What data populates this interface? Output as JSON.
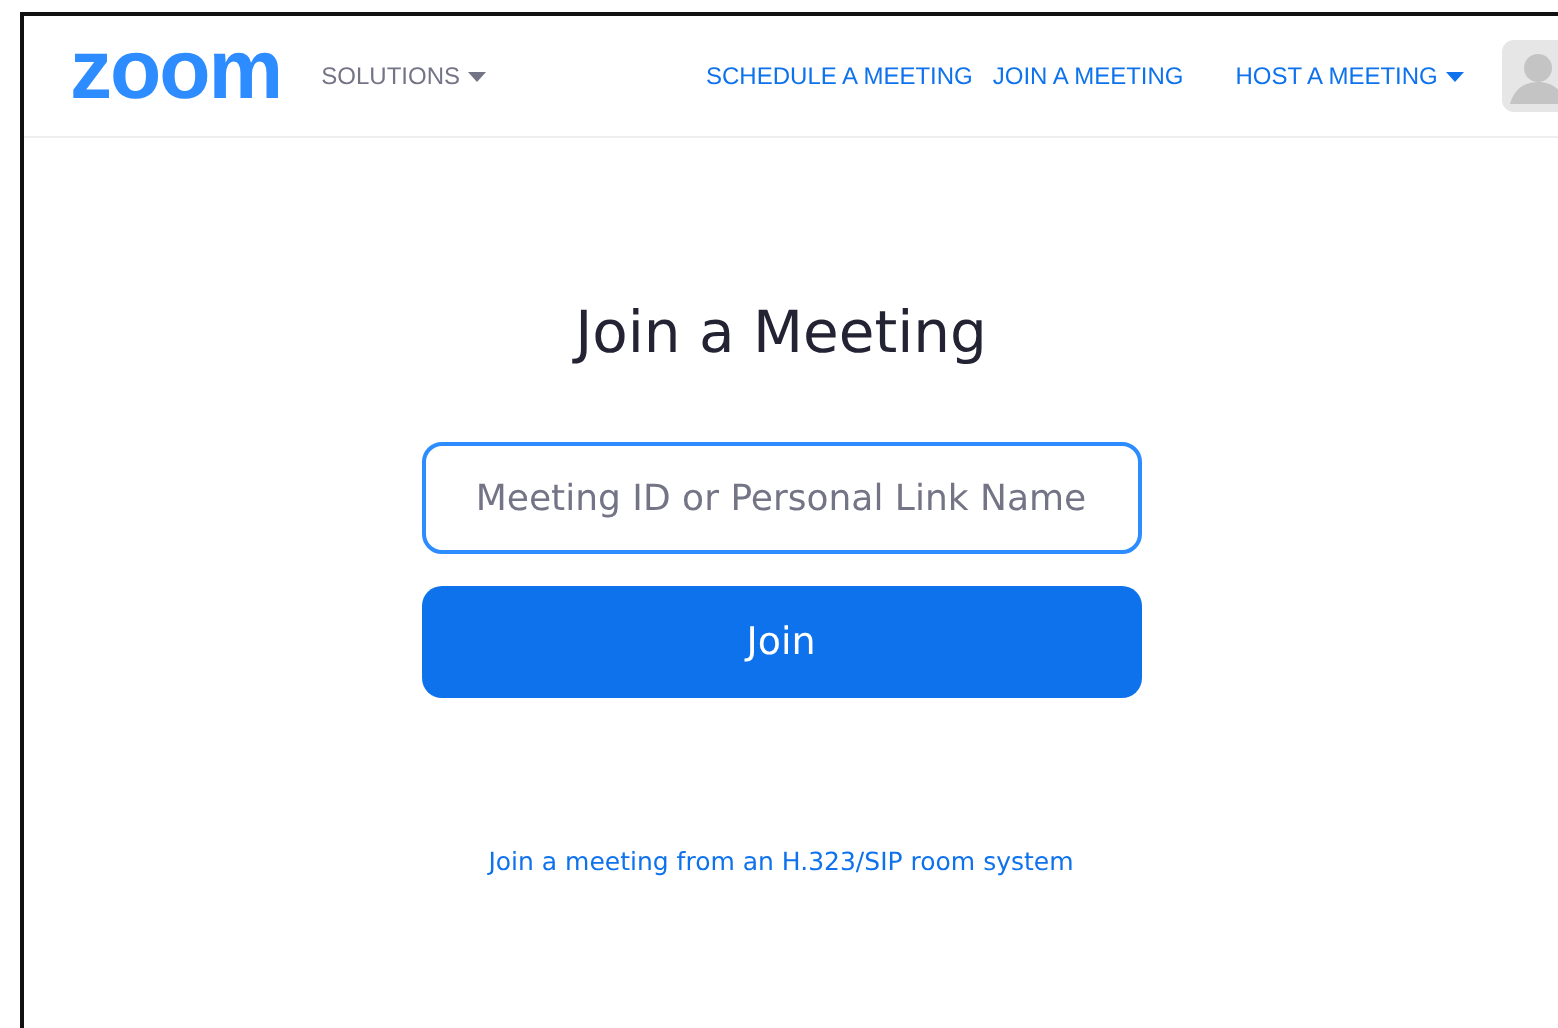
{
  "header": {
    "logo": "zoom",
    "nav_left": [
      {
        "label": "SOLUTIONS",
        "dropdown": true
      }
    ],
    "nav_right": [
      {
        "label": "SCHEDULE A MEETING",
        "dropdown": false
      },
      {
        "label": "JOIN A MEETING",
        "dropdown": false
      },
      {
        "label": "HOST A MEETING",
        "dropdown": true
      }
    ]
  },
  "title": "Join a Meeting",
  "meeting_field": {
    "placeholder": "Meeting ID or Personal Link Name",
    "focused": true
  },
  "join_button": "Join",
  "room_link": "Join a meeting from an H.323/SIP room system"
}
